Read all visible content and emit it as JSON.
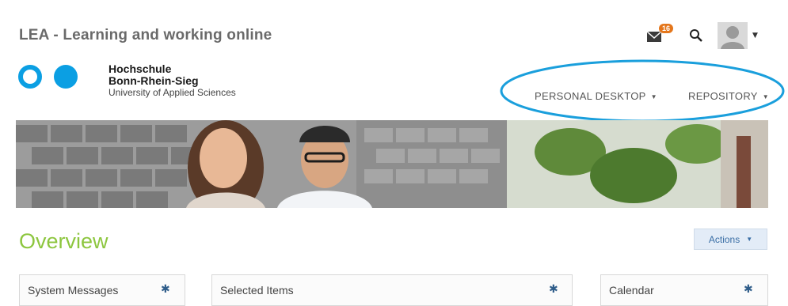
{
  "app": {
    "title": "LEA - Learning and working online"
  },
  "header": {
    "mail_badge": "16",
    "icons": [
      "mail-icon",
      "search-icon",
      "avatar",
      "chevron-down-icon"
    ]
  },
  "logo": {
    "line1": "Hochschule",
    "line2": "Bonn-Rhein-Sieg",
    "line3": "University of Applied Sciences"
  },
  "nav": {
    "items": [
      {
        "label": "PERSONAL DESKTOP"
      },
      {
        "label": "REPOSITORY"
      }
    ]
  },
  "page": {
    "title": "Overview",
    "actions_label": "Actions"
  },
  "panels": [
    {
      "title": "System Messages"
    },
    {
      "title": "Selected Items"
    },
    {
      "title": "Calendar"
    }
  ],
  "colors": {
    "accent_green": "#8dc63f",
    "brand_blue": "#0b9fe3",
    "badge_orange": "#e4761b",
    "highlight_blue": "#1a9fdc",
    "link_blue": "#2f5d8a"
  }
}
